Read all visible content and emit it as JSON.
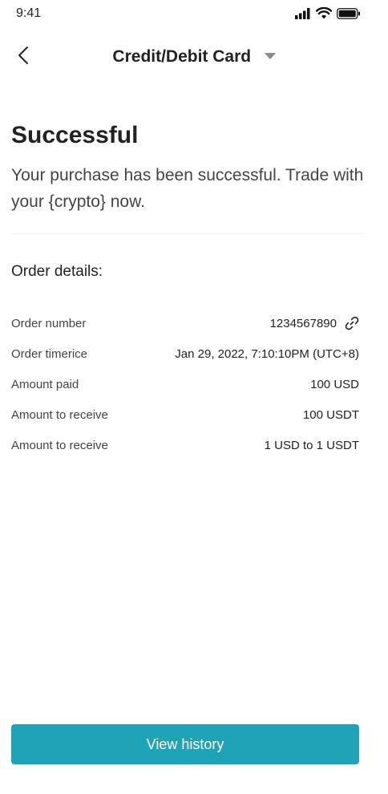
{
  "status_bar": {
    "time": "9:41",
    "icons": [
      "signal-icon",
      "wifi-icon",
      "battery-icon"
    ]
  },
  "header": {
    "title": "Credit/Debit Card",
    "back_icon": "chevron-left-icon",
    "dropdown_icon": "caret-down-icon"
  },
  "result": {
    "headline": "Successful",
    "message": "Your purchase has been successful. Trade with your {crypto} now."
  },
  "order": {
    "section_title": "Order details:",
    "rows": [
      {
        "label": "Order number",
        "value": "1234567890"
      },
      {
        "label": "Order timerice",
        "value": "Jan 29, 2022, 7:10:10PM (UTC+8)"
      },
      {
        "label": "Amount paid",
        "value": "100 USD"
      },
      {
        "label": "Amount to receive",
        "value": "100 USDT"
      },
      {
        "label": "Amount to receive",
        "value": "1 USD to 1 USDT"
      }
    ]
  },
  "actions": {
    "view_history_label": "View history"
  },
  "colors": {
    "accent": "#1fa3b6",
    "text_primary": "#222222",
    "text_secondary": "#444444"
  }
}
